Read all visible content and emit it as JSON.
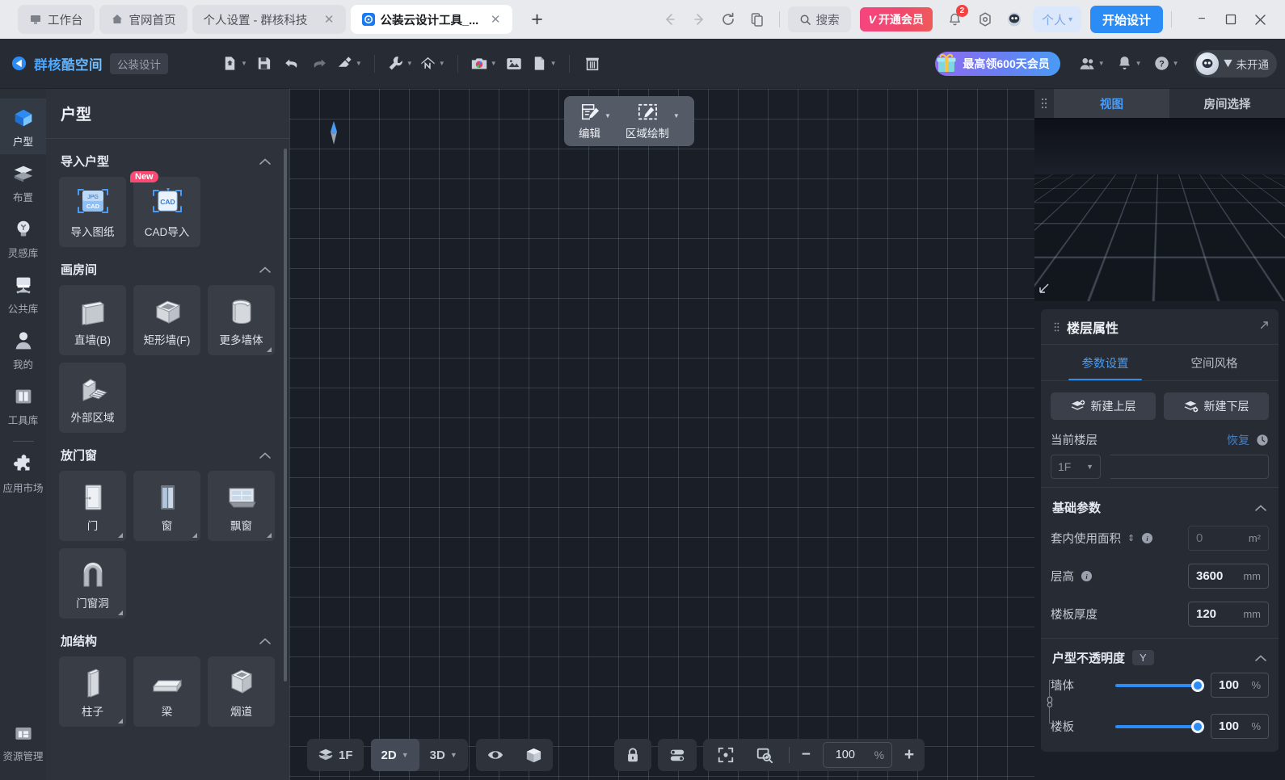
{
  "browser": {
    "tabs": [
      {
        "title": "工作台",
        "icon": "workbench-icon",
        "active": false,
        "closable": false
      },
      {
        "title": "官网首页",
        "icon": "home-icon",
        "active": false,
        "closable": false
      },
      {
        "title": "个人设置 - 群核科技",
        "icon": "",
        "active": false,
        "closable": true
      },
      {
        "title": "公装云设计工具_...",
        "icon": "app-icon",
        "active": true,
        "closable": true
      }
    ],
    "new_tab_label": "+",
    "nav": {
      "back": "←",
      "forward": "→",
      "reload": "⟳",
      "copy": "copy-icon"
    },
    "search_label": "搜索",
    "vip_label": "开通会员",
    "vip_mark": "V",
    "notification_count": "2",
    "person_label": "个人",
    "start_button": "开始设计",
    "window_controls": {
      "minimize": "−",
      "maximize": "▢",
      "close": "✕"
    }
  },
  "app_header": {
    "brand": "群核酷空间",
    "brand_tag": "公装设计",
    "tools": [
      {
        "name": "new-file-button",
        "caret": true
      },
      {
        "name": "save-button",
        "caret": false
      },
      {
        "name": "undo-button",
        "caret": false
      },
      {
        "name": "redo-button",
        "caret": false
      },
      {
        "name": "eraser-button",
        "caret": true
      },
      {
        "name": "wrench-button",
        "caret": true
      },
      {
        "name": "roof-button",
        "caret": true
      },
      {
        "name": "camera-button",
        "caret": true
      },
      {
        "name": "image-button",
        "caret": false
      },
      {
        "name": "document-button",
        "caret": true
      },
      {
        "name": "trash-button",
        "caret": false
      }
    ],
    "gift_label": "最高领600天会员",
    "membership_label": "未开通"
  },
  "rail": {
    "items": [
      {
        "label": "户型",
        "icon": "layout-icon",
        "active": true
      },
      {
        "label": "布置",
        "icon": "furnish-icon",
        "active": false
      },
      {
        "label": "灵感库",
        "icon": "bulb-icon",
        "active": false
      },
      {
        "label": "公共库",
        "icon": "chair-icon",
        "active": false
      },
      {
        "label": "我的",
        "icon": "user-icon",
        "active": false
      },
      {
        "label": "工具库",
        "icon": "toolbox-icon",
        "active": false
      },
      {
        "label": "应用市场",
        "icon": "puzzle-icon",
        "active": false
      }
    ],
    "bottom": {
      "label": "资源管理",
      "icon": "folder-icon"
    }
  },
  "left_panel": {
    "title": "户型",
    "sections": [
      {
        "title": "导入户型",
        "collapsed": false,
        "items": [
          {
            "label": "导入图纸",
            "icon": "jpg-cad-import-icon",
            "badge": "",
            "corner": false
          },
          {
            "label": "CAD导入",
            "icon": "cad-import-icon",
            "badge": "New",
            "corner": false
          }
        ]
      },
      {
        "title": "画房间",
        "collapsed": false,
        "items": [
          {
            "label": "直墙(B)",
            "icon": "straight-wall-icon",
            "badge": "",
            "corner": false
          },
          {
            "label": "矩形墙(F)",
            "icon": "rect-wall-icon",
            "badge": "",
            "corner": false
          },
          {
            "label": "更多墙体",
            "icon": "curved-wall-icon",
            "badge": "",
            "corner": true
          },
          {
            "label": "外部区域",
            "icon": "exterior-area-icon",
            "badge": "",
            "corner": false
          }
        ]
      },
      {
        "title": "放门窗",
        "collapsed": false,
        "items": [
          {
            "label": "门",
            "icon": "door-icon",
            "badge": "",
            "corner": true
          },
          {
            "label": "窗",
            "icon": "window-icon",
            "badge": "",
            "corner": true
          },
          {
            "label": "飘窗",
            "icon": "bay-window-icon",
            "badge": "",
            "corner": true
          },
          {
            "label": "门窗洞",
            "icon": "opening-icon",
            "badge": "",
            "corner": true
          }
        ]
      },
      {
        "title": "加结构",
        "collapsed": false,
        "items": [
          {
            "label": "柱子",
            "icon": "column-icon",
            "badge": "",
            "corner": true
          },
          {
            "label": "梁",
            "icon": "beam-icon",
            "badge": "",
            "corner": false
          },
          {
            "label": "烟道",
            "icon": "flue-icon",
            "badge": "",
            "corner": false
          }
        ]
      }
    ]
  },
  "canvas": {
    "float_toolbar": [
      {
        "label": "编辑",
        "icon": "edit-region-icon",
        "caret": true
      },
      {
        "label": "区域绘制",
        "icon": "draw-region-icon",
        "caret": true
      }
    ],
    "compass": "north-marker"
  },
  "bottom_bar": {
    "floor_label": "1F",
    "view_2d": "2D",
    "view_3d": "3D",
    "active_view": "2D",
    "eye_icon": "eye-icon",
    "cube_icon": "cube-icon",
    "lock_icon": "lock-icon",
    "settings_icon": "toggles-icon",
    "fit_icon": "fit-to-screen-icon",
    "zoom_region_icon": "zoom-region-icon",
    "zoom_out": "−",
    "zoom_value": "100",
    "zoom_unit": "%",
    "zoom_in": "+"
  },
  "right_panel": {
    "tabs": [
      {
        "label": "视图",
        "active": true
      },
      {
        "label": "房间选择",
        "active": false
      }
    ],
    "floor_properties": {
      "title": "楼层属性",
      "tabs": [
        {
          "label": "参数设置",
          "active": true
        },
        {
          "label": "空间风格",
          "active": false
        }
      ],
      "add_upper": "新建上层",
      "add_lower": "新建下层",
      "current_floor_label": "当前楼层",
      "restore_label": "恢复",
      "current_floor_value": "1F",
      "basic": {
        "title": "基础参数",
        "rows": [
          {
            "label": "套内使用面积",
            "value": "0",
            "unit": "m²",
            "disabled": true,
            "info": true,
            "sort": true
          },
          {
            "label": "层高",
            "value": "3600",
            "unit": "mm",
            "disabled": false,
            "info": true,
            "sort": false
          },
          {
            "label": "楼板厚度",
            "value": "120",
            "unit": "mm",
            "disabled": false,
            "info": false,
            "sort": false
          }
        ]
      },
      "opacity": {
        "title": "户型不透明度",
        "shortcut": "Y",
        "rows": [
          {
            "label": "墙体",
            "value": "100",
            "unit": "%"
          },
          {
            "label": "楼板",
            "value": "100",
            "unit": "%"
          }
        ]
      }
    }
  }
}
